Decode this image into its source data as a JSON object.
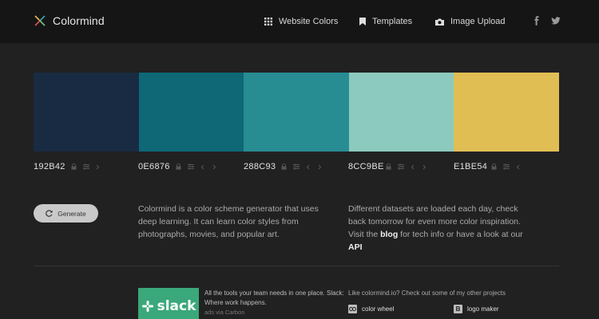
{
  "header": {
    "brand": "Colormind",
    "nav": [
      {
        "label": "Website Colors",
        "icon": "grid-icon"
      },
      {
        "label": "Templates",
        "icon": "bookmark-icon"
      },
      {
        "label": "Image Upload",
        "icon": "camera-icon"
      }
    ],
    "social": [
      {
        "icon": "facebook-icon"
      },
      {
        "icon": "twitter-icon"
      }
    ]
  },
  "palette": [
    {
      "hex": "192B42",
      "color": "#192B42"
    },
    {
      "hex": "0E6876",
      "color": "#0E6876"
    },
    {
      "hex": "288C93",
      "color": "#288C93"
    },
    {
      "hex": "8CC9BE",
      "color": "#8CC9BE"
    },
    {
      "hex": "E1BE54",
      "color": "#E1BE54"
    }
  ],
  "generate_label": "Generate",
  "intro": {
    "text": "Colormind is a color scheme generator that uses deep learning. It can learn color styles from photographs, movies, and popular art."
  },
  "info": {
    "text_before": "Different datasets are loaded each day, check back tomorrow for even more color inspiration. Visit the ",
    "blog_link": "blog",
    "text_middle": " for tech info or have a look at our ",
    "api_link": "API"
  },
  "ad": {
    "image_word": "slack",
    "line1": "All the tools your team needs in one place. Slack: Where work happens.",
    "via": "ads via Carbon"
  },
  "more": {
    "title": "Like colormind.io? Check out some of my other projects",
    "projects": [
      {
        "label": "color wheel",
        "icon": "color-wheel-icon"
      },
      {
        "label": "logo maker",
        "icon_letter": "B",
        "icon": "logo-maker-icon"
      }
    ]
  },
  "colors": {
    "background": "#212121",
    "header": "#151515",
    "button": "#c9c9c9",
    "ad_green": "#3aa87a"
  }
}
